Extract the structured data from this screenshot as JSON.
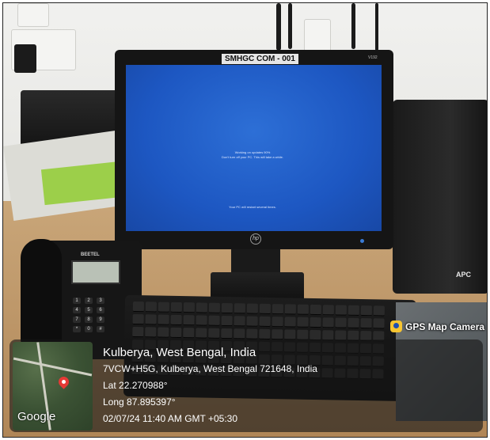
{
  "monitor": {
    "label": "SMHGC COM - 001",
    "model": "V192",
    "logo": "hp",
    "screen_lines": [
      "Working on updates  90%",
      "Don't turn off your PC. This will take a while.",
      "Your PC will restart several times."
    ]
  },
  "phone": {
    "brand": "BEETEL",
    "keys": [
      "1",
      "2",
      "3",
      "4",
      "5",
      "6",
      "7",
      "8",
      "9",
      "*",
      "0",
      "#"
    ]
  },
  "ups": {
    "logo": "APC"
  },
  "app_badge": {
    "label": "GPS Map Camera",
    "icon": "gps-map-camera-icon"
  },
  "map": {
    "provider_label": "Google"
  },
  "location": {
    "title": "Kulberya, West Bengal, India",
    "address": "7VCW+H5G, Kulberya, West Bengal 721648, India",
    "latitude": "Lat 22.270988°",
    "longitude": "Long 87.895397°",
    "timestamp": "02/07/24 11:40 AM GMT +05:30"
  },
  "colors": {
    "screen_blue": "#1d57c2",
    "overlay_bg": "rgba(22,22,22,0.62)",
    "pin_red": "#e53935",
    "desk": "#b08657"
  }
}
